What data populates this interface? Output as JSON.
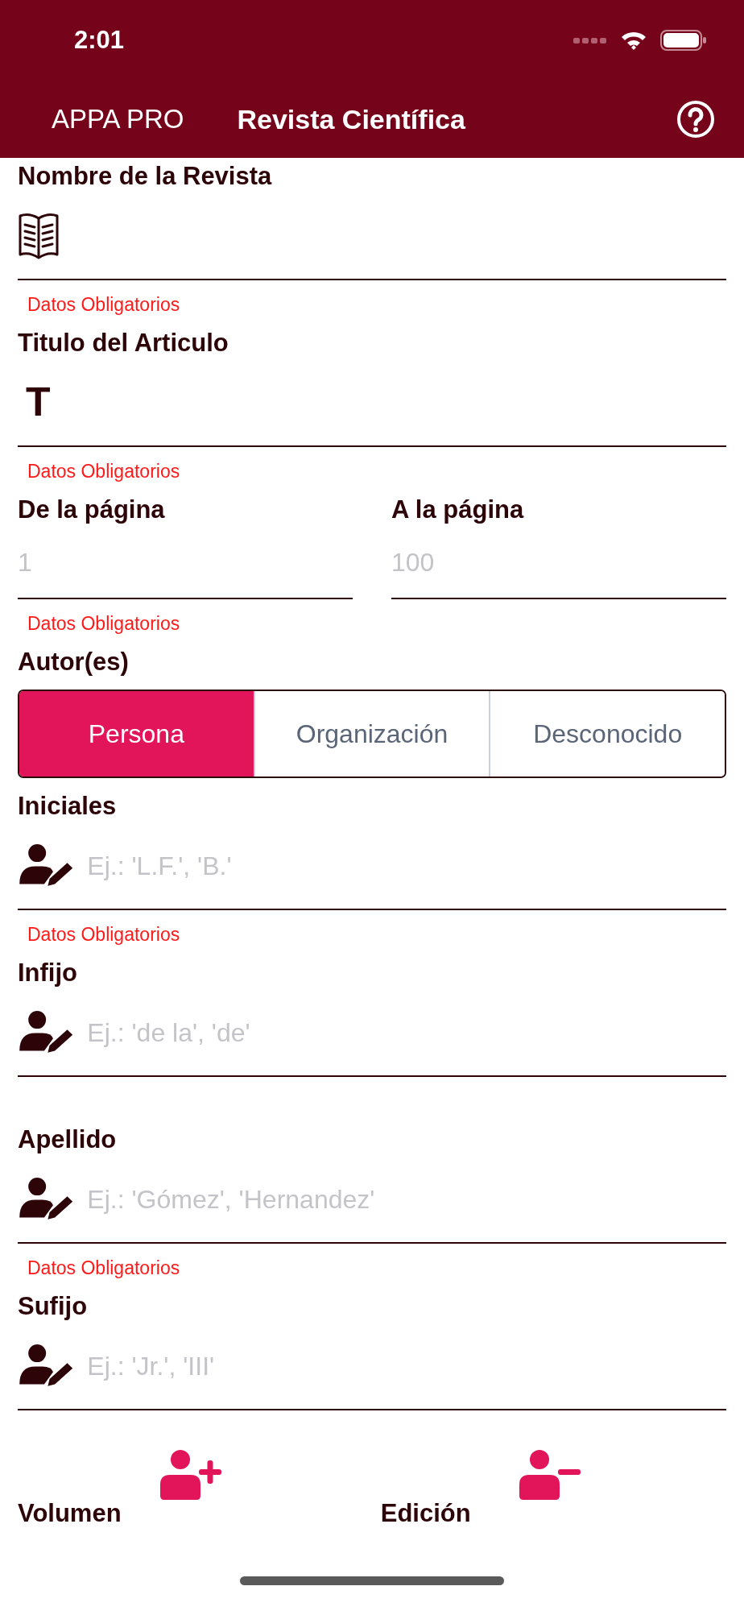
{
  "status_bar": {
    "time": "2:01"
  },
  "nav": {
    "back": "APPA PRO",
    "title": "Revista Científica"
  },
  "form": [
    {
      "kind": "book_field",
      "label": "Nombre de la Revista",
      "error": "Datos Obligatorios"
    },
    {
      "kind": "text_field",
      "label": "Titulo del Articulo",
      "glyph": "T",
      "error": "Datos Obligatorios"
    },
    {
      "kind": "page_pair",
      "fields": [
        {
          "label": "De la página",
          "placeholder": "1"
        },
        {
          "label": "A la página",
          "placeholder": "100"
        }
      ],
      "error": "Datos Obligatorios"
    },
    {
      "kind": "segmented",
      "label": "Autor(es)",
      "options": [
        {
          "label": "Persona",
          "selected": true
        },
        {
          "label": "Organización",
          "selected": false
        },
        {
          "label": "Desconocido",
          "selected": false
        }
      ]
    },
    {
      "kind": "person_field",
      "label": "Iniciales",
      "placeholder": "Ej.: 'L.F.', 'B.'",
      "error": "Datos Obligatorios"
    },
    {
      "kind": "person_field",
      "label": "Infijo",
      "placeholder": "Ej.: 'de la', 'de'"
    },
    {
      "kind": "person_field",
      "label": "Apellido",
      "placeholder": "Ej.: 'Gómez', 'Hernandez'",
      "error": "Datos Obligatorios"
    },
    {
      "kind": "person_field",
      "label": "Sufijo",
      "placeholder": "Ej.: 'Jr.', 'III'"
    }
  ],
  "footer": [
    {
      "label": "Volumen",
      "kind": "add"
    },
    {
      "label": "Edición",
      "kind": "remove"
    }
  ]
}
